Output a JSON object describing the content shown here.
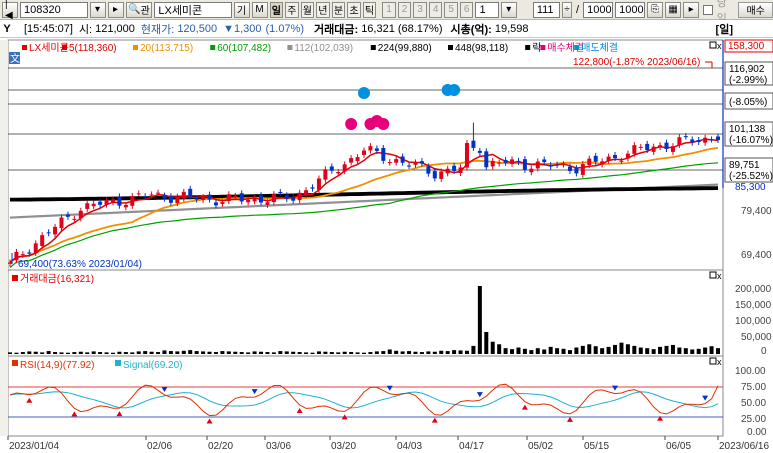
{
  "toolbar": {
    "stock_code": "108320",
    "search_label": "관",
    "stock_name": "LX세미콘",
    "btn_gi": "기",
    "btn_m": "M",
    "periods": [
      "일",
      "주",
      "월",
      "년",
      "분",
      "초",
      "틱"
    ],
    "active_period": "일",
    "numbers": [
      "1",
      "2",
      "3",
      "4",
      "5",
      "6",
      "1"
    ],
    "count": "111",
    "slash": "/",
    "total": "1000",
    "total2": "1000",
    "checkbox_label": "당일",
    "buy_label": "매수"
  },
  "infobar": {
    "icon": "Y",
    "time": "[15:45:07]",
    "open_label": "시:",
    "open_value": "121,000",
    "current_label": "현재가:",
    "current_value": "120,500",
    "change": "▼1,300",
    "change_pct": "(1.07%)",
    "amount_label": "거래대금:",
    "amount_value": "16,321",
    "amount_pct": "(68.17%)",
    "mcap_label": "시총(억):",
    "mcap_value": "19,598",
    "right_label": "[일]"
  },
  "colors": {
    "up": "#e0001c",
    "down": "#0032c8",
    "ma5": "#e00000",
    "ma20": "#f09000",
    "ma60": "#00a000",
    "ma112": "#909090",
    "ma224": "#000000",
    "ma448": "#000000",
    "buy": "#e8007a",
    "sell": "#0090e0",
    "rsi": "#e03000",
    "signal": "#20b0d0"
  },
  "price_panel": {
    "legend": [
      {
        "text": "LX세미콘",
        "color": "#e00000"
      },
      {
        "text": "5(118,360)",
        "color": "#e00000"
      },
      {
        "text": "20(113,715)",
        "color": "#f09000"
      },
      {
        "text": "60(107,482)",
        "color": "#00a000"
      },
      {
        "text": "112(102,039)",
        "color": "#909090"
      },
      {
        "text": "224(99,880)",
        "color": "#000000"
      },
      {
        "text": "448(98,118)",
        "color": "#000000"
      },
      {
        "text": "락",
        "color": "#000000"
      },
      {
        "text": "매수체결",
        "color": "#e8007a"
      },
      {
        "text": "매도체결",
        "color": "#0090e0"
      }
    ],
    "corner_label": "文",
    "high_label": "122,800(-1.87% 2023/06/16)",
    "low_label": "69,400(73.63% 2023/01/04)",
    "y_axis": [
      "158,300",
      "116,902",
      "(-2.99%)",
      "(-8.05%)",
      "101,138",
      "(-16.07%)",
      "89,751",
      "(-25.52%)",
      "85,300",
      "79,400",
      "69,400"
    ],
    "y_axis_hidden": [
      "128,500",
      "120,500",
      "105,100"
    ]
  },
  "volume_panel": {
    "legend": "거래대금(16,321)",
    "y_axis": [
      "200,000",
      "150,000",
      "100,000",
      "50,000",
      "0"
    ],
    "values": [
      5,
      4,
      6,
      8,
      7,
      5,
      9,
      6,
      5,
      4,
      6,
      7,
      5,
      8,
      6,
      5,
      4,
      7,
      6,
      5,
      8,
      9,
      7,
      6,
      11,
      9,
      8,
      10,
      12,
      9,
      8,
      7,
      6,
      9,
      8,
      7,
      6,
      5,
      8,
      7,
      6,
      5,
      9,
      8,
      7,
      6,
      5,
      4,
      8,
      7,
      6,
      5,
      7,
      6,
      5,
      4,
      6,
      8,
      9,
      14,
      10,
      8,
      9,
      7,
      6,
      8,
      7,
      10,
      9,
      12,
      11,
      10,
      25,
      210,
      68,
      38,
      30,
      18,
      15,
      20,
      16,
      12,
      18,
      14,
      22,
      18,
      16,
      12,
      20,
      25,
      30,
      24,
      18,
      22,
      28,
      35,
      30,
      25,
      20,
      18,
      15,
      22,
      25,
      28,
      20,
      18,
      14,
      16,
      20,
      24,
      18
    ]
  },
  "rsi_panel": {
    "legend_rsi": "RSI(14,9)(77.92)",
    "legend_signal": "Signal(69.20)",
    "y_axis": [
      "100.00",
      "75.00",
      "50.00",
      "25.00",
      "0.00"
    ],
    "upper": 70,
    "lower": 30
  },
  "x_axis": [
    "2023/01/04",
    "02/06",
    "02/20",
    "03/06",
    "03/20",
    "04/03",
    "04/17",
    "05/02",
    "05/15",
    "06/05",
    "2023/06/16"
  ],
  "chart_data": {
    "type": "line",
    "title": "LX세미콘",
    "x": [
      "2023/01/04",
      "02/06",
      "02/20",
      "03/06",
      "03/20",
      "04/03",
      "04/17",
      "05/02",
      "05/15",
      "06/05",
      "2023/06/16"
    ],
    "series": [
      {
        "name": "LX세미콘",
        "values": [
          70000,
          92000,
          97000,
          95000,
          96000,
          115000,
          106000,
          110000,
          108000,
          116000,
          120500
        ]
      },
      {
        "name": "5(118,360)",
        "values": [
          72000,
          90000,
          96000,
          95500,
          95000,
          112000,
          105000,
          110000,
          109000,
          115000,
          118360
        ]
      },
      {
        "name": "20(113,715)",
        "values": [
          75000,
          84000,
          93000,
          95000,
          94000,
          100000,
          104000,
          107000,
          108000,
          111000,
          113715
        ]
      },
      {
        "name": "60(107,482)",
        "values": [
          80000,
          81000,
          84000,
          88000,
          90000,
          93000,
          97000,
          100000,
          102000,
          105000,
          107482
        ]
      }
    ],
    "ylim": [
      69400,
      158300
    ]
  }
}
